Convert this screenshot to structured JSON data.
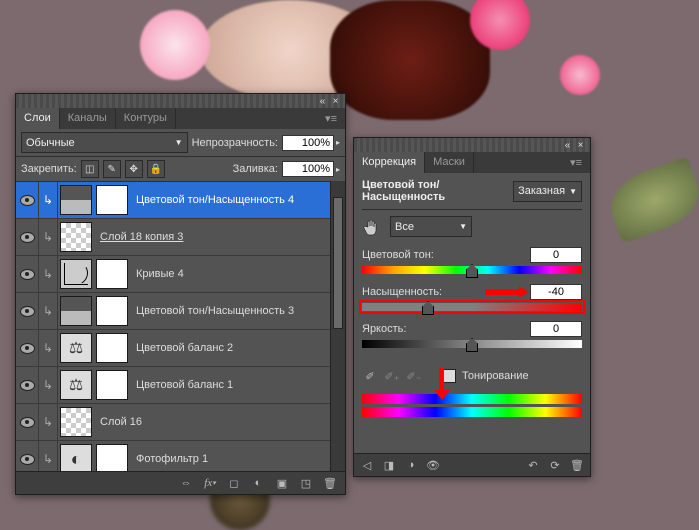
{
  "layers_panel": {
    "tabs": [
      "Слои",
      "Каналы",
      "Контуры"
    ],
    "active_tab": 0,
    "blend_mode": "Обычные",
    "opacity_label": "Непрозрачность:",
    "opacity_value": "100%",
    "lock_label": "Закрепить:",
    "fill_label": "Заливка:",
    "fill_value": "100%",
    "layers": [
      {
        "name": "Цветовой тон/Насыщенность 4",
        "kind": "hs",
        "selected": true,
        "indent": true
      },
      {
        "name": "Слой 18 копия 3",
        "kind": "pixel",
        "underline": true,
        "indent": true
      },
      {
        "name": "Кривые 4",
        "kind": "curves",
        "indent": true
      },
      {
        "name": "Цветовой тон/Насыщенность 3",
        "kind": "hs",
        "indent": true
      },
      {
        "name": "Цветовой баланс 2",
        "kind": "cb",
        "indent": true
      },
      {
        "name": "Цветовой баланс 1",
        "kind": "cb",
        "indent": true
      },
      {
        "name": "Слой 16",
        "kind": "pixel",
        "indent": true
      },
      {
        "name": "Фотофильтр 1",
        "kind": "photo",
        "indent": true
      }
    ]
  },
  "adj_panel": {
    "tabs": [
      "Коррекция",
      "Маски"
    ],
    "active_tab": 0,
    "title": "Цветовой тон/Насыщенность",
    "preset": "Заказная",
    "channel": "Все",
    "hue_label": "Цветовой тон:",
    "hue_value": "0",
    "sat_label": "Насыщенность:",
    "sat_value": "-40",
    "light_label": "Яркость:",
    "light_value": "0",
    "colorize_label": "Тонирование"
  }
}
